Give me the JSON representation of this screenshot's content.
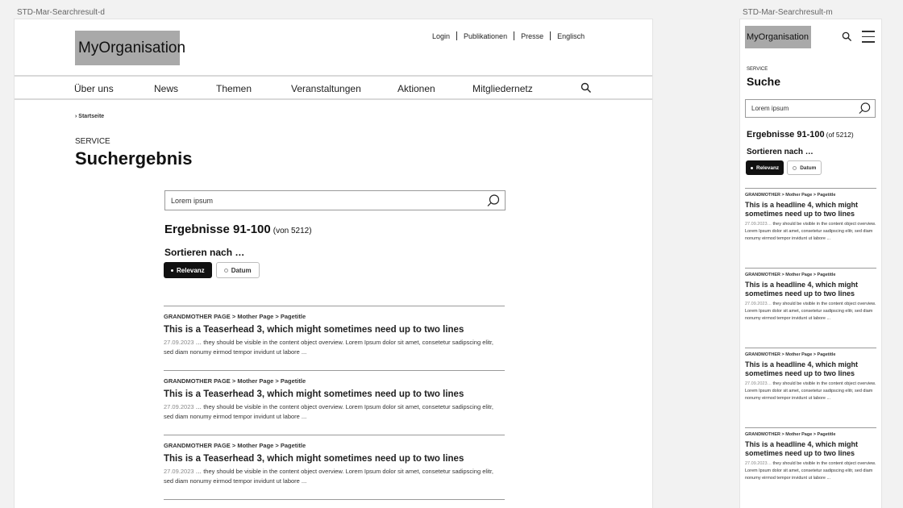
{
  "frames": {
    "desktop_label": "STD-Mar-Searchresult-d",
    "mobile_label": "STD-Mar-Searchresult-m"
  },
  "desktop": {
    "logo": "MyOrganisation",
    "meta_nav": [
      "Login",
      "Publikationen",
      "Presse",
      "Englisch"
    ],
    "main_nav": [
      "Über uns",
      "News",
      "Themen",
      "Veranstaltungen",
      "Aktionen",
      "Mitgliedernetz"
    ],
    "breadcrumb": "Startseite",
    "kicker": "SERVICE",
    "title": "Suchergebnis",
    "search_value": "Lorem ipsum",
    "result_count": "Ergebnisse 91-100",
    "result_total": "(von 5212)",
    "sort_label": "Sortieren nach …",
    "sort_options": [
      "Relevanz",
      "Datum"
    ],
    "results": [
      {
        "crumb": "GRANDMOTHER PAGE > Mother Page > Pagetitle",
        "title": "This is a Teaserhead 3, which might sometimes need up to two lines",
        "date": "27.09.2023",
        "text": " … they should be visible in the content object overview. Lorem Ipsum dolor sit amet, consetetur sadipscing elitr, sed diam nonumy eirmod tempor invidunt ut labore ..."
      },
      {
        "crumb": "GRANDMOTHER PAGE > Mother Page > Pagetitle",
        "title": "This is a Teaserhead 3, which might sometimes need up to two lines",
        "date": "27.09.2023",
        "text": " … they should be visible in the content object overview. Lorem Ipsum dolor sit amet, consetetur sadipscing elitr, sed diam nonumy eirmod tempor invidunt ut labore ..."
      },
      {
        "crumb": "GRANDMOTHER PAGE > Mother Page > Pagetitle",
        "title": "This is a Teaserhead 3, which might sometimes need up to two lines",
        "date": "27.09.2023",
        "text": " … they should be visible in the content object overview. Lorem Ipsum dolor sit amet, consetetur sadipscing elitr, sed diam nonumy eirmod tempor invidunt ut labore ..."
      }
    ]
  },
  "mobile": {
    "logo": "MyOrganisation",
    "kicker": "SERVICE",
    "title": "Suche",
    "search_value": "Lorem ipsum",
    "result_count": "Ergebnisse 91-100",
    "result_total": "(of 5212)",
    "sort_label": "Sortieren nach …",
    "sort_options": [
      "Relevanz",
      "Datum"
    ],
    "results": [
      {
        "crumb": "GRANDMOTHER  > Mother Page > Pagetitle",
        "title": "This is a headline 4, which might sometimes need up to two lines",
        "date": "27.09.2023…",
        "text": " they should be visible in the content object overview. Lorem Ipsum dolor sit amet, consetetur sadipscing elitr, sed diam nonumy eirmod tempor invidunt ut labore ..."
      },
      {
        "crumb": "GRANDMOTHER  > Mother Page > Pagetitle",
        "title": "This is a headline 4, which might sometimes need up to two lines",
        "date": "27.09.2023…",
        "text": " they should be visible in the content object overview. Lorem Ipsum dolor sit amet, consetetur sadipscing elitr, sed diam nonumy eirmod tempor invidunt ut labore ..."
      },
      {
        "crumb": "GRANDMOTHER  > Mother Page > Pagetitle",
        "title": "This is a headline 4, which might sometimes need up to two lines",
        "date": "27.09.2023…",
        "text": " they should be visible in the content object overview. Lorem Ipsum dolor sit amet, consetetur sadipscing elitr, sed diam nonumy eirmod tempor invidunt ut labore ..."
      },
      {
        "crumb": "GRANDMOTHER  > Mother Page > Pagetitle",
        "title": "This is a headline 4, which might sometimes need up to two lines",
        "date": "27.09.2023…",
        "text": " they should be visible in the content object overview. Lorem Ipsum dolor sit amet, consetetur sadipscing elitr, sed diam nonumy eirmod tempor invidunt ut labore ..."
      }
    ]
  }
}
